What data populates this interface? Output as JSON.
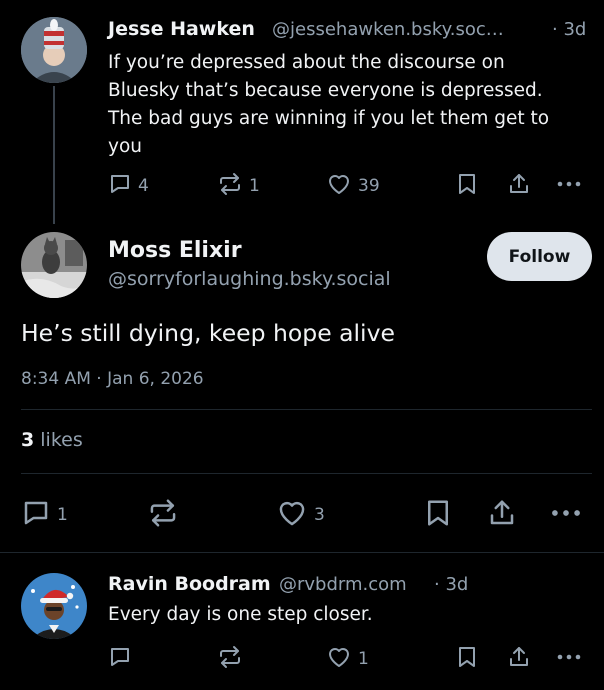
{
  "post1": {
    "name": "Jesse Hawken",
    "handle": "@jessehawken.bsky.soc…",
    "time": "· 3d",
    "text": "If you’re depressed about the discourse on Bluesky that’s because everyone is depressed. The bad guys are winning if you let them get to you",
    "replies": "4",
    "reposts": "1",
    "likes": "39"
  },
  "main_post": {
    "name": "Moss Elixir",
    "handle": "@sorryforlaughing.bsky.social",
    "follow_label": "Follow",
    "text": "He’s still dying, keep hope alive",
    "timestamp": "8:34 AM · Jan 6, 2026",
    "likes_count": "3",
    "likes_word": "likes",
    "replies": "1",
    "likes": "3"
  },
  "post3": {
    "name": "Ravin Boodram",
    "handle": "@rvbdrm.com",
    "time": "· 3d",
    "text": "Every day is one step closer.",
    "likes": "1"
  },
  "colors": {
    "background": "#000000",
    "text": "#f1f3f5",
    "muted": "#93a1af",
    "follow_bg": "#dfe5ec",
    "divider": "#1e262d"
  }
}
